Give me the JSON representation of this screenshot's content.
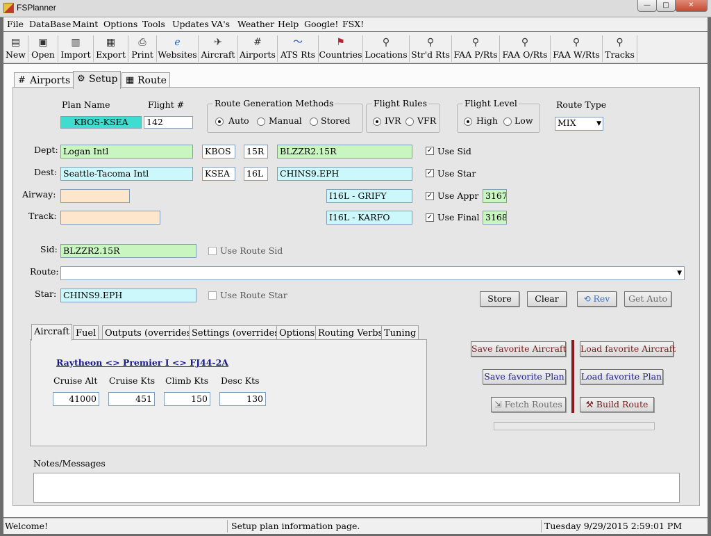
{
  "window": {
    "title": "FSPlanner",
    "min": "—",
    "max": "□",
    "close": "✕"
  },
  "menu": [
    "File",
    "DataBase",
    "Maint",
    "Options",
    "Tools",
    "Updates",
    "VA's",
    "Weather",
    "Help",
    "Google!",
    "FSX!"
  ],
  "toolbar": [
    {
      "label": "New",
      "icon": "new-document-icon",
      "glyph": "▤"
    },
    {
      "label": "Open",
      "icon": "open-icon",
      "glyph": "▣"
    },
    {
      "label": "Import",
      "icon": "import-icon",
      "glyph": "▥"
    },
    {
      "label": "Export",
      "icon": "export-icon",
      "glyph": "▦"
    },
    {
      "label": "Print",
      "icon": "printer-icon",
      "glyph": "⎙"
    },
    {
      "label": "Websites",
      "icon": "web-icon",
      "glyph": "ℯ"
    },
    {
      "label": "Aircraft",
      "icon": "airplane-icon",
      "glyph": "✈"
    },
    {
      "label": "Airports",
      "icon": "runway-icon",
      "glyph": "#"
    },
    {
      "label": "ATS Rts",
      "icon": "route-line-icon",
      "glyph": "〜"
    },
    {
      "label": "Countries",
      "icon": "flag-icon",
      "glyph": "⚑"
    },
    {
      "label": "Locations",
      "icon": "magnifier-icon",
      "glyph": "⚲"
    },
    {
      "label": "Str'd Rts",
      "icon": "magnifier-icon",
      "glyph": "⚲"
    },
    {
      "label": "FAA P/Rts",
      "icon": "magnifier-icon",
      "glyph": "⚲"
    },
    {
      "label": "FAA O/Rts",
      "icon": "magnifier-icon",
      "glyph": "⚲"
    },
    {
      "label": "FAA W/Rts",
      "icon": "magnifier-icon",
      "glyph": "⚲"
    },
    {
      "label": "Tracks",
      "icon": "magnifier-icon",
      "glyph": "⚲"
    }
  ],
  "tabs": [
    {
      "label": "Airports",
      "glyph": "#"
    },
    {
      "label": "Setup",
      "glyph": "⚙"
    },
    {
      "label": "Route",
      "glyph": "▦"
    }
  ],
  "setup": {
    "plan_name_label": "Plan Name",
    "plan_name": "KBOS-KSEA",
    "flight_label": "Flight #",
    "flight": "142",
    "rgm_title": "Route Generation Methods",
    "rgm_auto": "Auto",
    "rgm_manual": "Manual",
    "rgm_stored": "Stored",
    "rules_title": "Flight Rules",
    "rules_ivr": "IVR",
    "rules_vfr": "VFR",
    "level_title": "Flight Level",
    "level_high": "High",
    "level_low": "Low",
    "rtype_label": "Route Type",
    "rtype_value": "MIX",
    "dept_label": "Dept:",
    "dept_name": "Logan Intl",
    "dept_icao": "KBOS",
    "dept_rwy": "15R",
    "dept_proc": "BLZZR2.15R",
    "use_sid": "Use Sid",
    "dest_label": "Dest:",
    "dest_name": "Seattle-Tacoma Intl",
    "dest_icao": "KSEA",
    "dest_rwy": "16L",
    "dest_proc": "CHINS9.EPH",
    "use_star": "Use Star",
    "airway_label": "Airway:",
    "appr": "I16L - GRIFY",
    "use_appr": "Use Appr",
    "appr_alt": "3167",
    "track_label": "Track:",
    "final": "I16L - KARFO",
    "use_final": "Use Final",
    "final_alt": "3168",
    "sid_label": "Sid:",
    "sid": "BLZZR2.15R",
    "use_route_sid": "Use Route Sid",
    "route_label": "Route:",
    "star_label": "Star:",
    "star": "CHINS9.EPH",
    "use_route_star": "Use Route Star",
    "btn_store": "Store",
    "btn_clear": "Clear",
    "btn_rev": "Rev",
    "btn_get_auto": "Get Auto"
  },
  "inner_tabs": [
    "Aircraft",
    "Fuel",
    "Outputs (overrides)",
    "Settings (overrides)",
    "Options",
    "Routing Verbs",
    "Tuning"
  ],
  "aircraft": {
    "name": "Raytheon <> Premier I <> FJ44-2A",
    "cruise_alt_label": "Cruise  Alt",
    "cruise_alt": "41000",
    "cruise_kts_label": "Cruise  Kts",
    "cruise_kts": "451",
    "climb_kts_label": "Climb  Kts",
    "climb_kts": "150",
    "desc_kts_label": "Desc Kts",
    "desc_kts": "130"
  },
  "actions": {
    "save_aircraft": "Save favorite Aircraft",
    "load_aircraft": "Load favorite Aircraft",
    "save_plan": "Save favorite Plan",
    "load_plan": "Load favorite Plan",
    "fetch_routes": "Fetch Routes",
    "build_route": "Build Route"
  },
  "notes": {
    "label": "Notes/Messages"
  },
  "status": {
    "left": "Welcome!",
    "middle": "Setup plan information page.",
    "right": "Tuesday 9/29/2015 2:59:01 PM"
  }
}
